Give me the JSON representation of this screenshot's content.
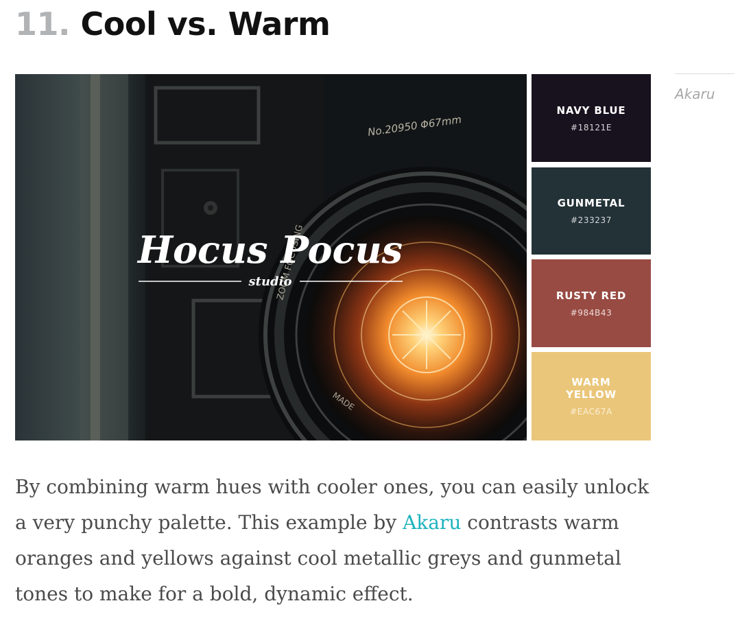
{
  "heading": {
    "number": "11.",
    "title": "Cool vs. Warm"
  },
  "image": {
    "logo_text": "Hocus Pocus",
    "logo_subtext": "studio",
    "lens_text_top": "No.20950  Φ67mm",
    "lens_text_side": "ZOOM  FOCUSING",
    "lens_text_bottom": "MADE"
  },
  "palette": [
    {
      "name": "NAVY BLUE",
      "hex": "#18121E",
      "text_color": "#ffffff",
      "hex_color": "#d8d8dc"
    },
    {
      "name": "GUNMETAL",
      "hex": "#233237",
      "text_color": "#ffffff",
      "hex_color": "#d5dadb"
    },
    {
      "name": "RUSTY RED",
      "hex": "#984B43",
      "text_color": "#ffffff",
      "hex_color": "#f0dcd9"
    },
    {
      "name": "WARM\nYELLOW",
      "hex": "#EAC67A",
      "text_color": "#ffffff",
      "hex_color": "#fbf0d8"
    }
  ],
  "caption": {
    "text": "Akaru"
  },
  "body": {
    "text_before": "By combining warm hues with cooler ones, you can easily unlock a very punchy palette. This example by ",
    "link_text": "Akaru",
    "text_after": " contrasts warm oranges and yellows against cool metallic greys and gunmetal tones to make for a bold, dynamic effect."
  }
}
